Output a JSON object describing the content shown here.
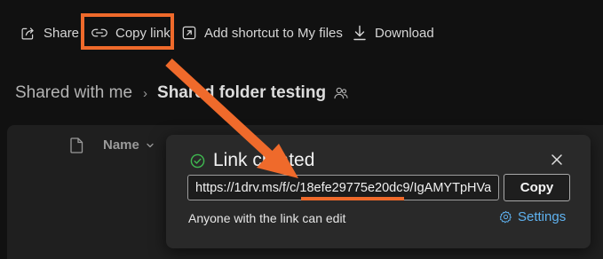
{
  "command_bar": {
    "share_label": "Share",
    "copy_link_label": "Copy link",
    "add_shortcut_label": "Add shortcut to My files",
    "download_label": "Download"
  },
  "breadcrumb": {
    "root": "Shared with me",
    "current": "Shared folder testing"
  },
  "file_list": {
    "name_column": "Name"
  },
  "dialog": {
    "title": "Link created",
    "link_value": "https://1drv.ms/f/c/18efe29775e20dc9/IgAMYTpHVa...",
    "copy_button": "Copy",
    "permission_text": "Anyone with the link can edit",
    "settings_link": "Settings"
  },
  "colors": {
    "annotation_orange": "#ef6a2b",
    "success_green": "#3fb950",
    "link_blue": "#5fb2f0"
  },
  "icons": {
    "share": "share-icon",
    "copy_link": "link-icon",
    "add_shortcut": "shortcut-icon",
    "download": "download-icon",
    "people": "people-icon",
    "file": "file-icon",
    "sort": "chevron-down-icon",
    "success": "check-circle-icon",
    "close": "close-icon",
    "settings": "gear-icon"
  }
}
